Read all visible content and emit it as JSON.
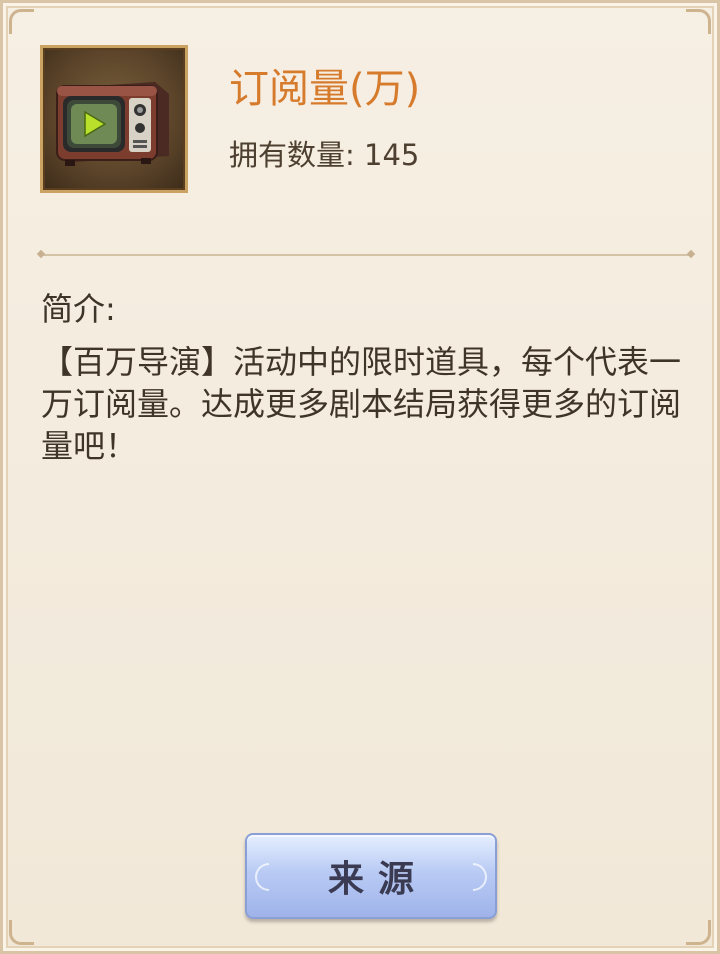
{
  "item": {
    "name": "订阅量(万)",
    "owned_label": "拥有数量:",
    "owned_count": "145",
    "icon": "retro-tv-icon"
  },
  "description": {
    "heading": "简介:",
    "text": "【百万导演】活动中的限时道具，每个代表一万订阅量。达成更多剧本结局获得更多的订阅量吧！"
  },
  "actions": {
    "source_label": "来源"
  },
  "colors": {
    "title_accent": "#d67a2c",
    "panel_background": "#f4ecdf",
    "button_blue": "#b9cbf4"
  }
}
